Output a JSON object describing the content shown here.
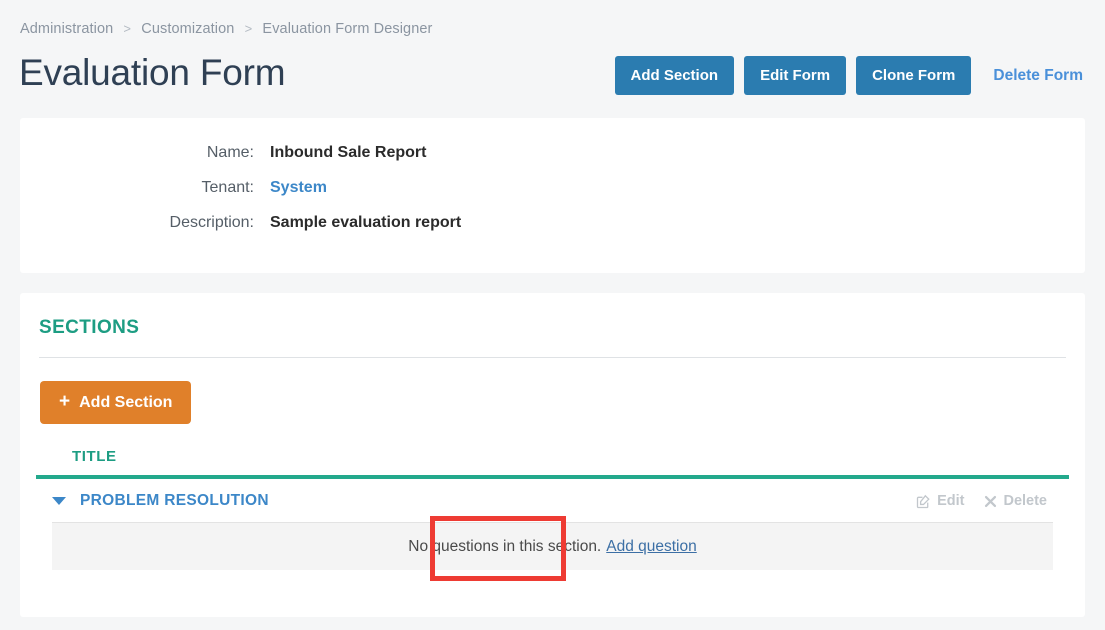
{
  "breadcrumb": {
    "items": [
      {
        "label": "Administration"
      },
      {
        "label": "Customization"
      },
      {
        "label": "Evaluation Form Designer"
      }
    ],
    "separator": ">"
  },
  "header": {
    "title": "Evaluation Form",
    "actions": {
      "add_section": "Add Section",
      "edit_form": "Edit Form",
      "clone_form": "Clone Form",
      "delete_form": "Delete Form"
    }
  },
  "info": {
    "rows": [
      {
        "label": "Name:",
        "value": "Inbound Sale Report",
        "is_link": false
      },
      {
        "label": "Tenant:",
        "value": "System",
        "is_link": true
      },
      {
        "label": "Description:",
        "value": "Sample evaluation report",
        "is_link": false
      }
    ]
  },
  "sections_panel": {
    "heading": "SECTIONS",
    "add_section_button": "Add Section",
    "add_icon": "plus-icon",
    "table": {
      "columns": [
        "TITLE"
      ],
      "rows": [
        {
          "caret_icon": "caret-down-icon",
          "title": "PROBLEM RESOLUTION",
          "edit_label": "Edit",
          "edit_icon": "pencil-square-icon",
          "delete_label": "Delete",
          "delete_icon": "close-x-icon",
          "empty_message": "No questions in this section.",
          "add_question_link": "Add question"
        }
      ]
    }
  },
  "annotation": {
    "target": "add-question-link",
    "color": "#ee3b33"
  },
  "colors": {
    "page_background": "#f5f6f7",
    "card_background": "#ffffff",
    "primary_button": "#2b7cb0",
    "orange_button": "#e0802a",
    "teal_accent": "#23a98c",
    "teal_heading": "#1d9d83",
    "link_blue": "#3c87c8",
    "title_text": "#2f4054",
    "muted_text": "#c2c7cc",
    "strip_background": "#f4f4f4",
    "annotation_red": "#ee3b33"
  }
}
